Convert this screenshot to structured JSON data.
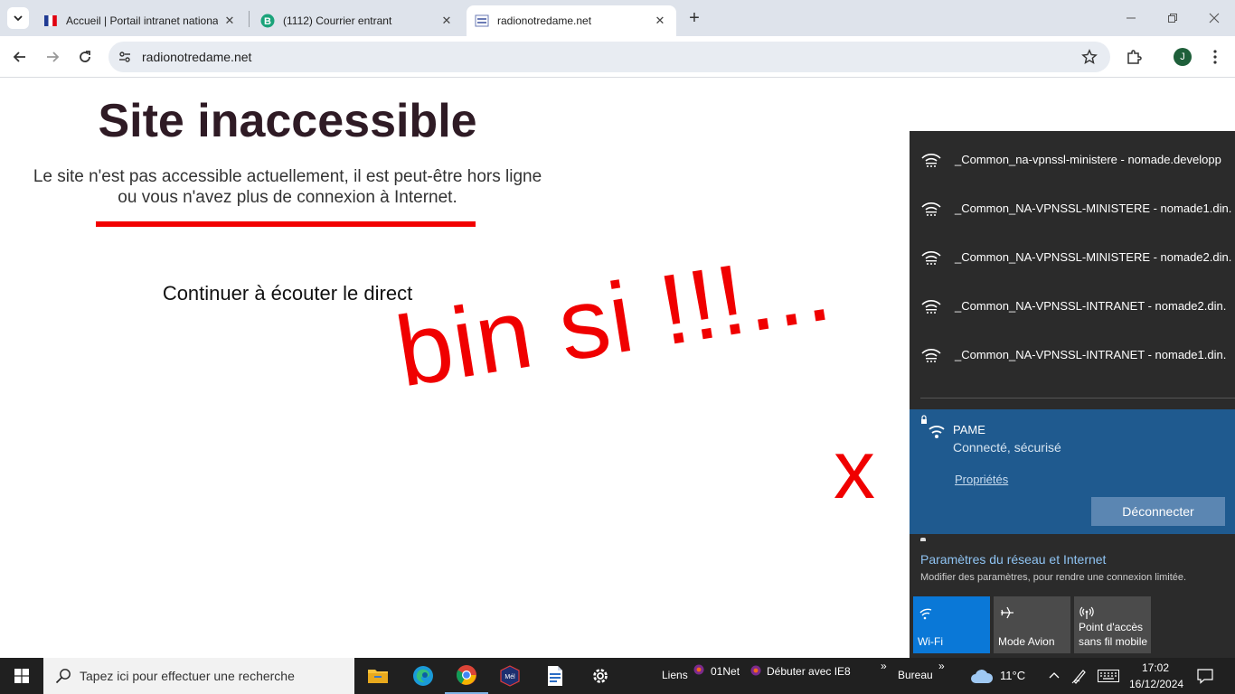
{
  "browser": {
    "tabs": [
      {
        "title": "Accueil | Portail intranet nationa",
        "active": false
      },
      {
        "title": "(1112) Courrier entrant",
        "active": false
      },
      {
        "title": "radionotredame.net",
        "active": true
      }
    ],
    "url": "radionotredame.net",
    "profile_initial": "J"
  },
  "page": {
    "title": "Site inaccessible",
    "message_line1": "Le site n'est pas accessible actuellement, il est peut-être hors ligne",
    "message_line2": "ou vous n'avez plus de connexion à Internet.",
    "continue_link": "Continuer à écouter le direct",
    "annotation_text": "bin si !!!...",
    "annotation_mark": "x"
  },
  "network_flyout": {
    "networks": [
      "_Common_na-vpnssl-ministere - nomade.developp",
      "_Common_NA-VPNSSL-MINISTERE - nomade1.din.",
      "_Common_NA-VPNSSL-MINISTERE - nomade2.din.",
      "_Common_NA-VPNSSL-INTRANET - nomade2.din.",
      "_Common_NA-VPNSSL-INTRANET - nomade1.din."
    ],
    "connected": {
      "name": "PAME",
      "status": "Connecté, sécurisé",
      "properties_label": "Propriétés",
      "disconnect_label": "Déconnecter"
    },
    "settings_title": "Paramètres du réseau et Internet",
    "settings_subtitle": "Modifier des paramètres, pour rendre une connexion limitée.",
    "quick_actions": [
      {
        "label": "Wi-Fi",
        "active": true,
        "icon": "wifi-icon"
      },
      {
        "label": "Mode Avion",
        "active": false,
        "icon": "airplane-icon"
      },
      {
        "label": "Point d'accès sans fil mobile",
        "label_line1": "Point d'accès",
        "label_line2": "sans fil mobile",
        "active": false,
        "icon": "hotspot-icon"
      }
    ]
  },
  "taskbar": {
    "search_placeholder": "Tapez ici pour effectuer une recherche",
    "links_label": "Liens",
    "link_items": [
      "01Net",
      "Débuter avec IE8"
    ],
    "desktop_label": "Bureau",
    "weather": "11°C",
    "time": "17:02",
    "date": "16/12/2024"
  },
  "colors": {
    "accent_red": "#f00000",
    "flyout_bg": "#2b2b2b",
    "connected_bg": "#1f5a8f",
    "wifi_active": "#0a78d7",
    "taskbar_bg": "#202020"
  }
}
